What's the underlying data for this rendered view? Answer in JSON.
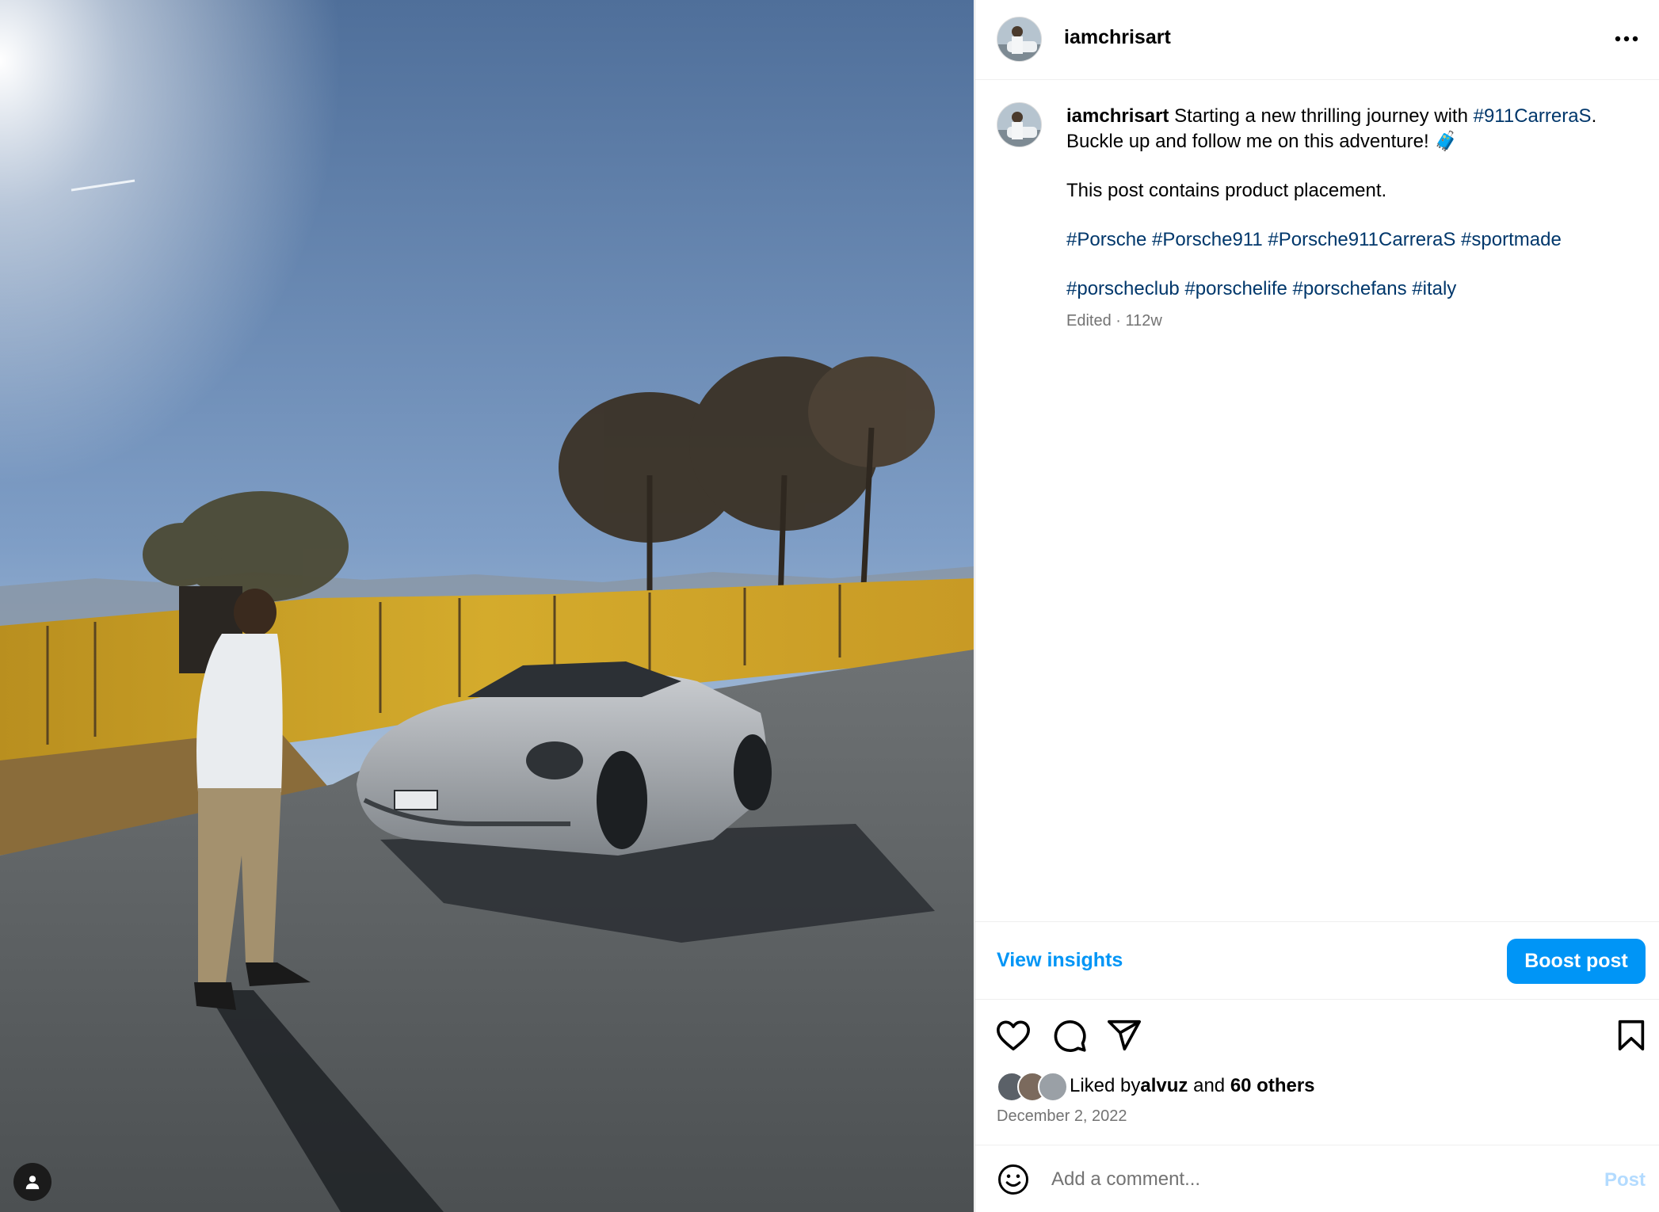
{
  "post": {
    "username": "iamchrisart",
    "more_icon": "more-horizontal-icon",
    "caption": {
      "username": "iamchrisart",
      "text_before_link": " Starting a new thrilling journey with ",
      "link_tag": "#911CarreraS",
      "text_after_link": ".",
      "line2": "Buckle up and follow me on this adventure! ",
      "line2_emoji": "🧳",
      "disclosure": "This post contains product placement.",
      "hashtags_line1": "#Porsche #Porsche911 #Porsche911CarreraS #sportmade",
      "hashtags_line2": "#porscheclub #porschelife #porschefans #italy",
      "edited_label": "Edited",
      "separator": "·",
      "age": "112w"
    },
    "insights": {
      "view_label": "View insights",
      "boost_label": "Boost post"
    },
    "actions": {
      "like_icon": "heart-icon",
      "comment_icon": "comment-icon",
      "share_icon": "share-icon",
      "save_icon": "bookmark-icon"
    },
    "likes": {
      "prefix": "Liked by ",
      "first_liker": "alvuz",
      "conjunction": " and ",
      "others": "60 others"
    },
    "date": "December 2, 2022",
    "comment": {
      "placeholder": "Add a comment...",
      "post_label": "Post",
      "emoji_icon": "emoji-smile-icon"
    },
    "photo": {
      "tags_icon": "user-tag-icon"
    }
  },
  "colors": {
    "link": "#00376b",
    "accent": "#0095f6",
    "muted": "#737373",
    "border": "#dbdbdb",
    "post_disabled": "#b3dbff"
  }
}
